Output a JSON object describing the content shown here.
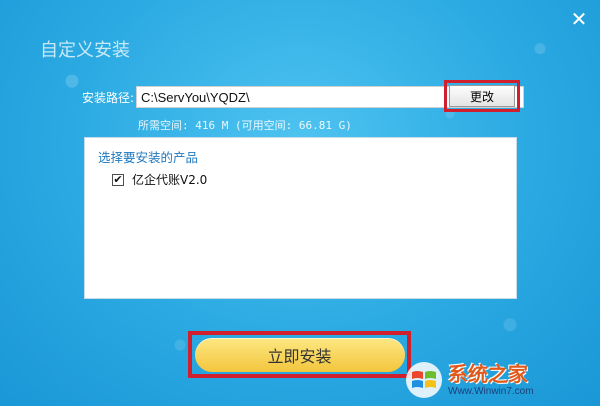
{
  "window": {
    "title": "自定义安装",
    "close_glyph": "✕"
  },
  "install_path": {
    "label": "安装路径:",
    "value": "C:\\ServYou\\YQDZ\\",
    "change_label": "更改"
  },
  "space_info": "所需空间: 416 M (可用空间: 66.81 G)",
  "products": {
    "header": "选择要安装的产品",
    "items": [
      {
        "name": "亿企代账V2.0",
        "checked": true
      }
    ]
  },
  "install_button": "立即安装",
  "watermark": {
    "title": "系统之家",
    "url": "Www.Winwin7.com",
    "icon": "windows-logo-icon"
  },
  "colors": {
    "background": "#2aa9e2",
    "highlight_border": "#d0202e",
    "install_button": "#f3c63c",
    "header_text": "#1f78bf"
  }
}
